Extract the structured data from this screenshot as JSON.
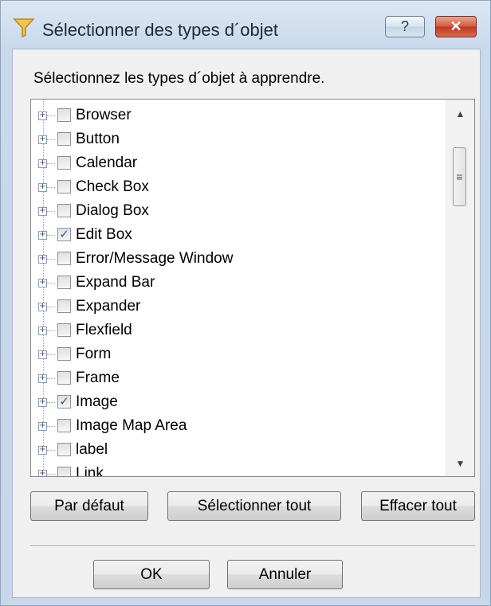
{
  "window": {
    "title": "Sélectionner des types d´objet",
    "help_label": "?",
    "close_label": "✕"
  },
  "prompt": "Sélectionnez les types d´objet à apprendre.",
  "items": [
    {
      "label": "Browser",
      "checked": false
    },
    {
      "label": "Button",
      "checked": false
    },
    {
      "label": "Calendar",
      "checked": false
    },
    {
      "label": "Check Box",
      "checked": false
    },
    {
      "label": "Dialog Box",
      "checked": false
    },
    {
      "label": "Edit Box",
      "checked": true
    },
    {
      "label": "Error/Message Window",
      "checked": false
    },
    {
      "label": "Expand Bar",
      "checked": false
    },
    {
      "label": "Expander",
      "checked": false
    },
    {
      "label": "Flexfield",
      "checked": false
    },
    {
      "label": "Form",
      "checked": false
    },
    {
      "label": "Frame",
      "checked": false
    },
    {
      "label": "Image",
      "checked": true
    },
    {
      "label": "Image Map Area",
      "checked": false
    },
    {
      "label": "label",
      "checked": false
    },
    {
      "label": "Link",
      "checked": false
    }
  ],
  "buttons": {
    "default": "Par défaut",
    "select_all": "Sélectionner tout",
    "clear_all": "Effacer tout",
    "ok": "OK",
    "cancel": "Annuler"
  },
  "icons": {
    "title": "filter-icon",
    "expander": "plus-icon",
    "check": "checkmark-icon"
  },
  "colors": {
    "check": "#2c5ea8",
    "close_button": "#c0391f"
  }
}
